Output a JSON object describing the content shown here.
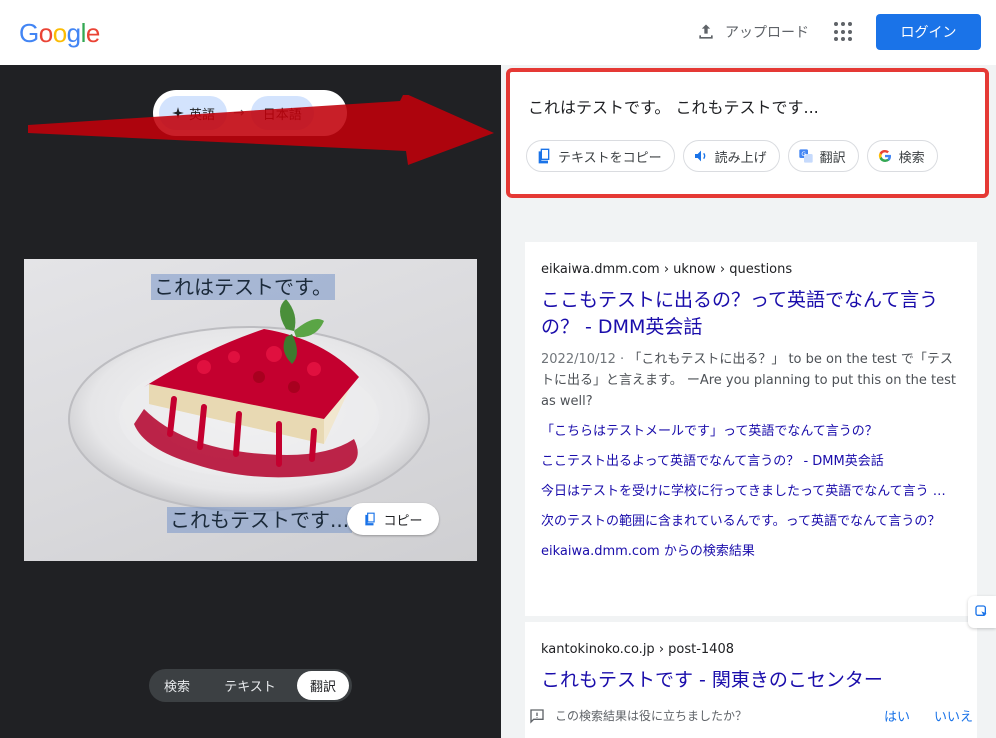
{
  "header": {
    "logo": [
      "G",
      "o",
      "o",
      "g",
      "l",
      "e"
    ],
    "logo_colors": [
      "#4285f4",
      "#ea4335",
      "#fbbc05",
      "#4285f4",
      "#34a853",
      "#ea4335"
    ],
    "upload_label": "アップロード",
    "login_label": "ログイン"
  },
  "lens": {
    "source_lang": "英語",
    "target_lang": "日本語",
    "arrow_glyph": "→",
    "overlay_text_1": "これはテストです。",
    "overlay_text_2": "これもテストです...",
    "copy_chip_label": "コピー",
    "modes": [
      "検索",
      "テキスト",
      "翻訳"
    ],
    "active_mode": "翻訳"
  },
  "ocr": {
    "text": "これはテストです。 これもテストです...",
    "actions": {
      "copy_text": "テキストをコピー",
      "read_aloud": "読み上げ",
      "translate": "翻訳",
      "search": "検索"
    }
  },
  "results": [
    {
      "breadcrumb": "eikaiwa.dmm.com › uknow › questions",
      "title": "ここもテストに出るの？って英語でなんて言うの？ - DMM英会話",
      "date": "2022/10/12 · ",
      "snippet": "「これもテストに出る？」 to be on the test で「テストに出る」と言えます。 ーAre you planning to put this on the test as well?",
      "sub_links": [
        "「こちらはテストメールです」って英語でなんて言うの？",
        "ここテスト出るよって英語でなんて言うの？ - DMM英会話",
        "今日はテストを受けに学校に行ってきましたって英語でなんて言う …",
        "次のテストの範囲に含まれているんです。って英語でなんて言うの？"
      ],
      "from_source": "eikaiwa.dmm.com からの検索結果"
    },
    {
      "breadcrumb": "kantokinoko.co.jp › post-1408",
      "title": "これもテストです - 関東きのこセンター"
    }
  ],
  "feedback": {
    "question": "この検索結果は役に立ちましたか？",
    "yes": "はい",
    "no": "いいえ"
  },
  "colors": {
    "accent_blue": "#1a73e8",
    "link_blue": "#1a0dab",
    "annotation_red": "#e53935",
    "dark_pane": "#202124"
  }
}
